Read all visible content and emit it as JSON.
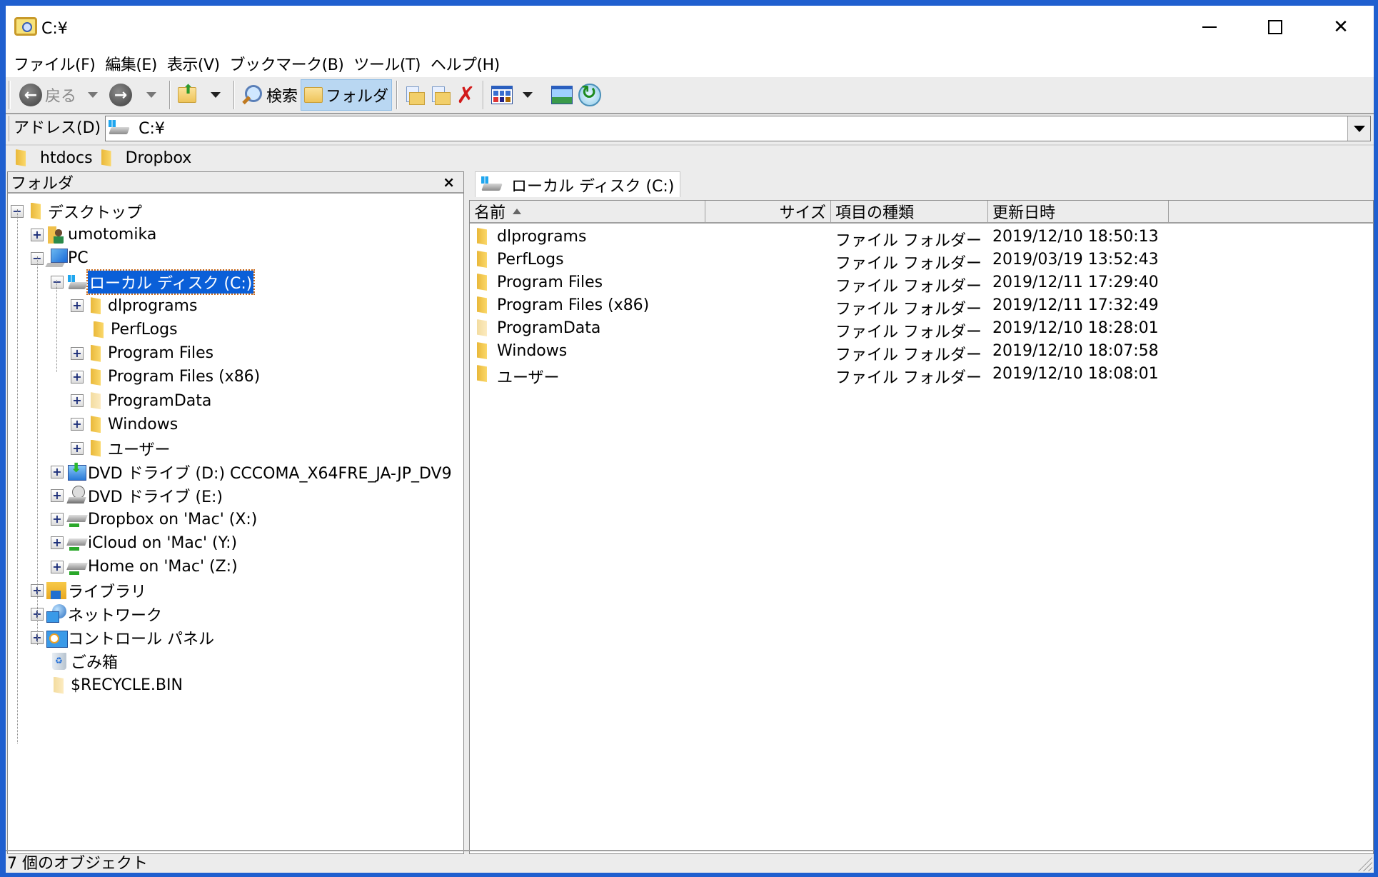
{
  "window": {
    "title": "C:¥",
    "controls": {
      "minimize": "minimize",
      "maximize": "maximize",
      "close": "close"
    }
  },
  "menubar": [
    "ファイル(F)",
    "編集(E)",
    "表示(V)",
    "ブックマーク(B)",
    "ツール(T)",
    "ヘルプ(H)"
  ],
  "toolbar": {
    "back_label": "戻る",
    "search_label": "検索",
    "folder_label": "フォルダ"
  },
  "address": {
    "label": "アドレス(D)",
    "value": "C:¥"
  },
  "links": [
    "htdocs",
    "Dropbox"
  ],
  "folder_pane": {
    "title": "フォルダ",
    "close_glyph": "×",
    "tree": [
      {
        "label": "デスクトップ",
        "level": 0,
        "expander": "minus",
        "icon": "folder"
      },
      {
        "label": "umotomika",
        "level": 1,
        "expander": "plus",
        "icon": "user"
      },
      {
        "label": "PC",
        "level": 1,
        "expander": "minus",
        "icon": "pc"
      },
      {
        "label": "ローカル ディスク (C:)",
        "level": 2,
        "expander": "minus",
        "icon": "drive",
        "selected": true
      },
      {
        "label": "dlprograms",
        "level": 3,
        "expander": "plus",
        "icon": "folder"
      },
      {
        "label": "PerfLogs",
        "level": 3,
        "expander": "none",
        "icon": "folder"
      },
      {
        "label": "Program Files",
        "level": 3,
        "expander": "plus",
        "icon": "folder"
      },
      {
        "label": "Program Files (x86)",
        "level": 3,
        "expander": "plus",
        "icon": "folder"
      },
      {
        "label": "ProgramData",
        "level": 3,
        "expander": "plus",
        "icon": "folder-pale"
      },
      {
        "label": "Windows",
        "level": 3,
        "expander": "plus",
        "icon": "folder"
      },
      {
        "label": "ユーザー",
        "level": 3,
        "expander": "plus",
        "icon": "folder"
      },
      {
        "label": "DVD ドライブ (D:) CCCOMA_X64FRE_JA-JP_DV9",
        "level": 2,
        "expander": "plus",
        "icon": "dvd"
      },
      {
        "label": "DVD ドライブ (E:)",
        "level": 2,
        "expander": "plus",
        "icon": "dvd2"
      },
      {
        "label": "Dropbox on 'Mac' (X:)",
        "level": 2,
        "expander": "plus",
        "icon": "netdrive"
      },
      {
        "label": "iCloud on 'Mac' (Y:)",
        "level": 2,
        "expander": "plus",
        "icon": "netdrive"
      },
      {
        "label": "Home on 'Mac' (Z:)",
        "level": 2,
        "expander": "plus",
        "icon": "netdrive"
      },
      {
        "label": "ライブラリ",
        "level": 1,
        "expander": "plus",
        "icon": "library"
      },
      {
        "label": "ネットワーク",
        "level": 1,
        "expander": "plus",
        "icon": "network"
      },
      {
        "label": "コントロール パネル",
        "level": 1,
        "expander": "plus",
        "icon": "control"
      },
      {
        "label": "ごみ箱",
        "level": 1,
        "expander": "none",
        "icon": "recycle"
      },
      {
        "label": "$RECYCLE.BIN",
        "level": 1,
        "expander": "none",
        "icon": "folder-pale"
      }
    ]
  },
  "content": {
    "tab_label": "ローカル ディスク (C:)",
    "columns": [
      "名前",
      "サイズ",
      "項目の種類",
      "更新日時"
    ],
    "sort_column": "名前",
    "sort_direction": "ascending",
    "rows": [
      {
        "name": "dlprograms",
        "size": "",
        "type": "ファイル フォルダー",
        "modified": "2019/12/10 18:50:13",
        "pale": false
      },
      {
        "name": "PerfLogs",
        "size": "",
        "type": "ファイル フォルダー",
        "modified": "2019/03/19 13:52:43",
        "pale": false
      },
      {
        "name": "Program Files",
        "size": "",
        "type": "ファイル フォルダー",
        "modified": "2019/12/11 17:29:40",
        "pale": false
      },
      {
        "name": "Program Files (x86)",
        "size": "",
        "type": "ファイル フォルダー",
        "modified": "2019/12/11 17:32:49",
        "pale": false
      },
      {
        "name": "ProgramData",
        "size": "",
        "type": "ファイル フォルダー",
        "modified": "2019/12/10 18:28:01",
        "pale": true
      },
      {
        "name": "Windows",
        "size": "",
        "type": "ファイル フォルダー",
        "modified": "2019/12/10 18:07:58",
        "pale": false
      },
      {
        "name": "ユーザー",
        "size": "",
        "type": "ファイル フォルダー",
        "modified": "2019/12/10 18:08:01",
        "pale": false
      }
    ]
  },
  "status": {
    "text": "7 個のオブジェクト"
  },
  "colors": {
    "selection": "#0a5fd8",
    "active_toolbar_button": "#b9d7f2",
    "chrome": "#ececec",
    "desktop_border": "#1f5fcf"
  }
}
